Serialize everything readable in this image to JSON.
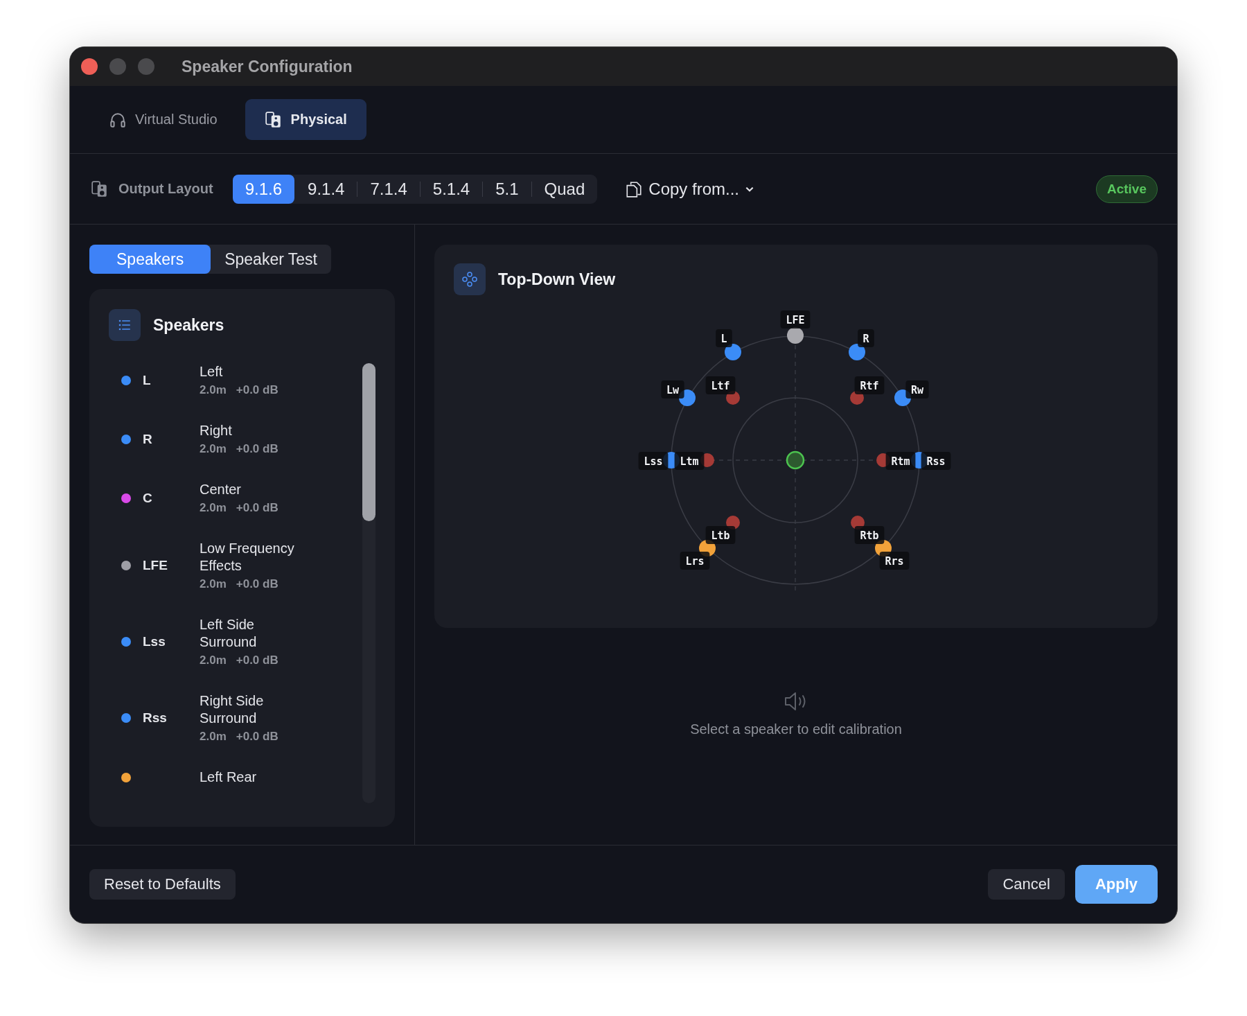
{
  "window": {
    "title": "Speaker Configuration"
  },
  "mode_tabs": [
    {
      "label": "Virtual Studio",
      "kind": "headphones",
      "selected": false
    },
    {
      "label": "Physical",
      "kind": "speakers",
      "selected": true
    }
  ],
  "output_layout": {
    "label": "Output Layout",
    "options": [
      {
        "label": "9.1.6",
        "selected": true
      },
      {
        "label": "9.1.4",
        "selected": false
      },
      {
        "label": "7.1.4",
        "selected": false
      },
      {
        "label": "5.1.4",
        "selected": false
      },
      {
        "label": "5.1",
        "selected": false
      },
      {
        "label": "Quad",
        "selected": false
      }
    ],
    "copy_from": "Copy from...",
    "status": "Active"
  },
  "panel_tabs": [
    {
      "label": "Speakers",
      "selected": true
    },
    {
      "label": "Speaker Test",
      "selected": false
    }
  ],
  "speakers_card": {
    "title": "Speakers",
    "speakers": [
      {
        "code": "L",
        "name": "Left",
        "distance": "2.0m",
        "gain": "+0.0 dB",
        "color": "#3b8cf7"
      },
      {
        "code": "R",
        "name": "Right",
        "distance": "2.0m",
        "gain": "+0.0 dB",
        "color": "#3b8cf7"
      },
      {
        "code": "C",
        "name": "Center",
        "distance": "2.0m",
        "gain": "+0.0 dB",
        "color": "#d94ae8"
      },
      {
        "code": "LFE",
        "name": "Low Frequency Effects",
        "distance": "2.0m",
        "gain": "+0.0 dB",
        "color": "#9e9ea6"
      },
      {
        "code": "Lss",
        "name": "Left Side Surround",
        "distance": "2.0m",
        "gain": "+0.0 dB",
        "color": "#3b8cf7"
      },
      {
        "code": "Rss",
        "name": "Right Side Surround",
        "distance": "2.0m",
        "gain": "+0.0 dB",
        "color": "#3b8cf7"
      },
      {
        "name": "Left Rear",
        "color": "#f2a23a"
      }
    ]
  },
  "top_down_view": {
    "title": "Top-Down View",
    "speakers": [
      {
        "label": "L",
        "color": "#3b8cf7"
      },
      {
        "label": "LFE",
        "color": "#a9a9ae"
      },
      {
        "label": "R",
        "color": "#3b8cf7"
      },
      {
        "label": "Lw",
        "color": "#3b8cf7"
      },
      {
        "label": "Ltf",
        "color": "#a63a36"
      },
      {
        "label": "Rtf",
        "color": "#a63a36"
      },
      {
        "label": "Rw",
        "color": "#3b8cf7"
      },
      {
        "label": "Lss",
        "color": "#3b8cf7"
      },
      {
        "label": "Ltm",
        "color": "#a63a36"
      },
      {
        "label": "Rtm",
        "color": "#a63a36"
      },
      {
        "label": "Rss",
        "color": "#3b8cf7"
      },
      {
        "label": "Ltb",
        "color": "#a63a36"
      },
      {
        "label": "Rtb",
        "color": "#a63a36"
      },
      {
        "label": "Lrs",
        "color": "#f2a23a"
      },
      {
        "label": "Rrs",
        "color": "#f2a23a"
      }
    ]
  },
  "calibration_hint": "Select a speaker to edit calibration",
  "footer": {
    "reset": "Reset to Defaults",
    "cancel": "Cancel",
    "apply": "Apply"
  }
}
